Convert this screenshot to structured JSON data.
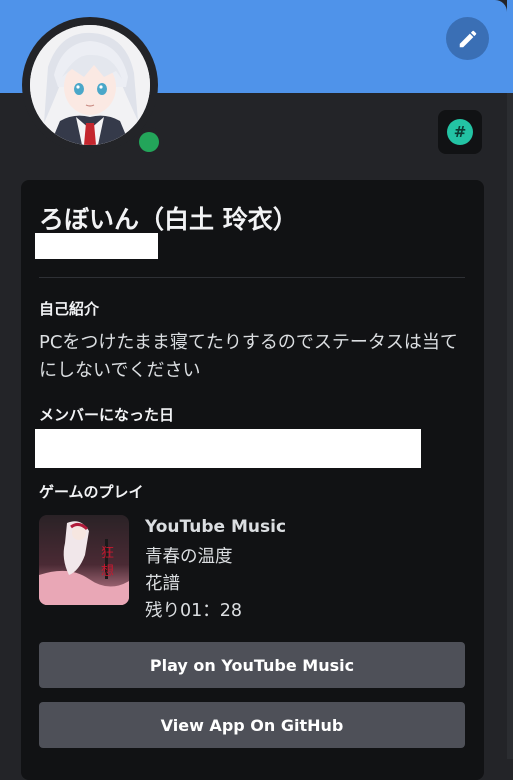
{
  "profile": {
    "display_name": "ろぼいん（白土 玲衣）",
    "banner_color": "#4f93ea",
    "status": "online",
    "status_color": "#23a55a",
    "badge_icon": "hashtag-badge-icon",
    "edit_icon": "pencil-icon"
  },
  "about": {
    "heading": "自己紹介",
    "text": "PCをつけたまま寝てたりするのでステータスは当てにしないでください"
  },
  "member_since": {
    "heading": "メンバーになった日"
  },
  "activity": {
    "heading": "ゲームのプレイ",
    "app_name": "YouTube Music",
    "details": "青春の温度",
    "state": "花譜",
    "time_remaining": "残り01：28",
    "buttons": [
      {
        "label": "Play on YouTube Music"
      },
      {
        "label": "View App On GitHub"
      }
    ]
  }
}
